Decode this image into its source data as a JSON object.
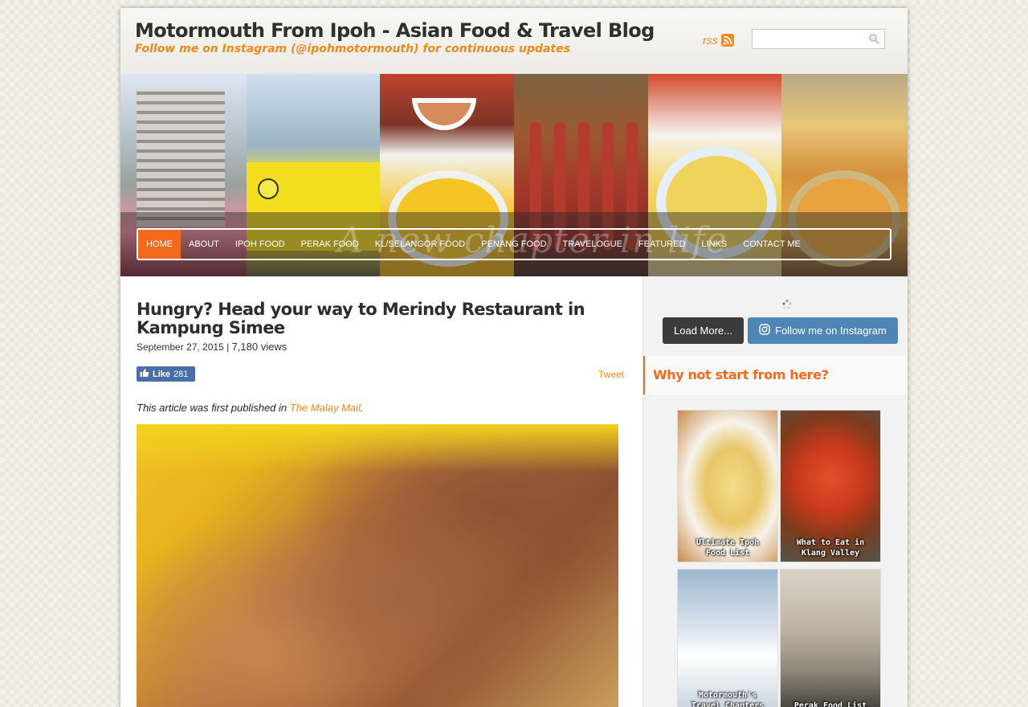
{
  "site": {
    "title": "Motormouth From Ipoh - Asian Food & Travel Blog",
    "tagline": "Follow me on Instagram (@ipohmotormouth) for continuous updates",
    "rss_label": "rss",
    "search_placeholder": ""
  },
  "banner": {
    "script_text": "A new chapter in life"
  },
  "nav": {
    "items": [
      {
        "label": "HOME",
        "active": true
      },
      {
        "label": "ABOUT"
      },
      {
        "label": "IPOH FOOD"
      },
      {
        "label": "PERAK FOOD"
      },
      {
        "label": "KL/SELANGOR FOOD"
      },
      {
        "label": "PENANG FOOD"
      },
      {
        "label": "TRAVELOGUE"
      },
      {
        "label": "FEATURED"
      },
      {
        "label": "LINKS"
      },
      {
        "label": "CONTACT ME"
      }
    ]
  },
  "post": {
    "title": "Hungry? Head your way to Merindy Restaurant in Kampung Simee",
    "date": "September 27, 2015",
    "separator": "|",
    "views": "7,180 views",
    "like_label": "Like",
    "like_count": "281",
    "tweet_label": "Tweet",
    "intro_prefix": "This article was first published in",
    "intro_link": "The Malay Mail",
    "intro_suffix": "."
  },
  "sidebar": {
    "load_more_label": "Load More...",
    "follow_label": "Follow me on Instagram",
    "heading": "Why not start from here?",
    "thumbs": [
      {
        "caption": "Ultimate Ipoh\nFood List"
      },
      {
        "caption": "What to Eat in\nKlang Valley"
      },
      {
        "caption": "Motormouth's\nTravel Chapters"
      },
      {
        "caption": "Perak Food List"
      }
    ]
  },
  "colors": {
    "accent": "#f26a1b",
    "link": "#f08a1c",
    "follow_button": "#4f86b5",
    "like_button": "#4a6ea9"
  }
}
